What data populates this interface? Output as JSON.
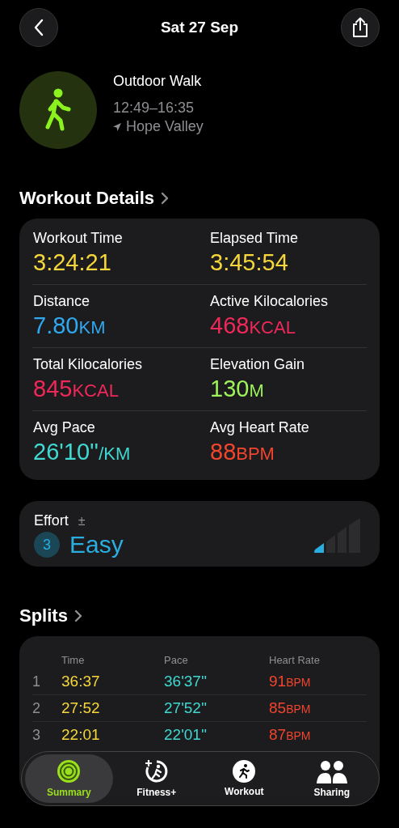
{
  "header": {
    "title": "Sat 27 Sep"
  },
  "workout": {
    "name": "Outdoor Walk",
    "time_range": "12:49–16:35",
    "location": "Hope Valley"
  },
  "details": {
    "heading": "Workout Details",
    "metrics": [
      {
        "label": "Workout Time",
        "value": "3:24:21",
        "color": "#f5d63b"
      },
      {
        "label": "Elapsed Time",
        "value": "3:45:54",
        "color": "#f5d63b"
      },
      {
        "label": "Distance",
        "value": "7.80",
        "unit": "KM",
        "color": "#2fa8f0"
      },
      {
        "label": "Active Kilocalories",
        "value": "468",
        "unit": "KCAL",
        "color": "#f0285a"
      },
      {
        "label": "Total Kilocalories",
        "value": "845",
        "unit": "KCAL",
        "color": "#f0285a"
      },
      {
        "label": "Elevation Gain",
        "value": "130",
        "unit": "M",
        "color": "#9ef25a"
      },
      {
        "label": "Avg Pace",
        "value": "26'10''",
        "unit": "/KM",
        "color": "#3fd9d2"
      },
      {
        "label": "Avg Heart Rate",
        "value": "88",
        "unit": "BPM",
        "color": "#f2452e"
      }
    ]
  },
  "effort": {
    "label": "Effort",
    "adjust": "±",
    "score": "3",
    "rating": "Easy"
  },
  "splits": {
    "heading": "Splits",
    "columns": [
      "Time",
      "Pace",
      "Heart Rate"
    ],
    "rows": [
      {
        "index": "1",
        "time": "36:37",
        "pace": "36'37''",
        "heart_rate": "91",
        "unit": "BPM"
      },
      {
        "index": "2",
        "time": "27:52",
        "pace": "27'52''",
        "heart_rate": "85",
        "unit": "BPM"
      },
      {
        "index": "3",
        "time": "22:01",
        "pace": "22'01''",
        "heart_rate": "87",
        "unit": "BPM"
      }
    ]
  },
  "tab_bar": [
    {
      "label": "Summary",
      "kind": "rings",
      "selected": true
    },
    {
      "label": "Fitness+",
      "kind": "fitness",
      "selected": false
    },
    {
      "label": "Workout",
      "kind": "runner",
      "selected": false
    },
    {
      "label": "Sharing",
      "kind": "people",
      "selected": false
    }
  ]
}
